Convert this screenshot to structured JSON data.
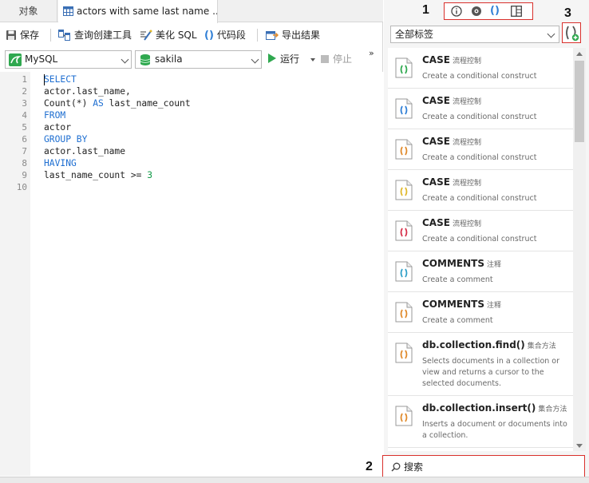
{
  "tabs": {
    "objects": "对象",
    "query": "actors with same last name ..."
  },
  "toolbar": {
    "save": "保存",
    "query_builder": "查询创建工具",
    "beautify_sql": "美化 SQL",
    "snippet": "代码段",
    "export": "导出结果"
  },
  "connection": {
    "db_type": "MySQL",
    "database": "sakila",
    "run": "运行",
    "stop": "停止",
    "more": "»"
  },
  "editor": {
    "lines": [
      "1",
      "2",
      "3",
      "4",
      "5",
      "6",
      "7",
      "8",
      "9",
      "10"
    ],
    "code": [
      [
        {
          "t": "SELECT",
          "c": "kw"
        }
      ],
      [
        {
          "t": "actor.last_name,",
          "c": ""
        }
      ],
      [
        {
          "t": "Count(*) ",
          "c": ""
        },
        {
          "t": "AS",
          "c": "kw"
        },
        {
          "t": " last_name_count",
          "c": ""
        }
      ],
      [
        {
          "t": "FROM",
          "c": "kw"
        }
      ],
      [
        {
          "t": "actor",
          "c": ""
        }
      ],
      [
        {
          "t": "GROUP BY",
          "c": "kw"
        }
      ],
      [
        {
          "t": "actor.last_name",
          "c": ""
        }
      ],
      [
        {
          "t": "HAVING",
          "c": "kw"
        }
      ],
      [
        {
          "t": "last_name_count >= ",
          "c": ""
        },
        {
          "t": "3",
          "c": "num"
        }
      ],
      []
    ]
  },
  "right_panel": {
    "filter": "全部标签",
    "search_placeholder": "搜索",
    "annotations": {
      "n1": "1",
      "n2": "2",
      "n3": "3"
    },
    "snippets": [
      {
        "title": "CASE",
        "tag": "流程控制",
        "desc": "Create a conditional construct",
        "color": "#2fa84f"
      },
      {
        "title": "CASE",
        "tag": "流程控制",
        "desc": "Create a conditional construct",
        "color": "#2f7fd6"
      },
      {
        "title": "CASE",
        "tag": "流程控制",
        "desc": "Create a conditional construct",
        "color": "#e08a2c"
      },
      {
        "title": "CASE",
        "tag": "流程控制",
        "desc": "Create a conditional construct",
        "color": "#e0b82c"
      },
      {
        "title": "CASE",
        "tag": "流程控制",
        "desc": "Create a conditional construct",
        "color": "#d6304a"
      },
      {
        "title": "COMMENTS",
        "tag": "注释",
        "desc": "Create a comment",
        "color": "#2fa0c8"
      },
      {
        "title": "COMMENTS",
        "tag": "注释",
        "desc": "Create a comment",
        "color": "#e08a2c"
      },
      {
        "title": "db.collection.find()",
        "tag": "集合方法",
        "desc": "Selects documents in a collection or view and returns a cursor to the selected documents.",
        "color": "#e08a2c"
      },
      {
        "title": "db.collection.insert()",
        "tag": "集合方法",
        "desc": "Inserts a document or documents into a collection.",
        "color": "#e08a2c"
      }
    ]
  },
  "colors": {
    "keyword": "#1f6fd1",
    "number": "#109a47",
    "highlight_box": "#d9302c"
  }
}
